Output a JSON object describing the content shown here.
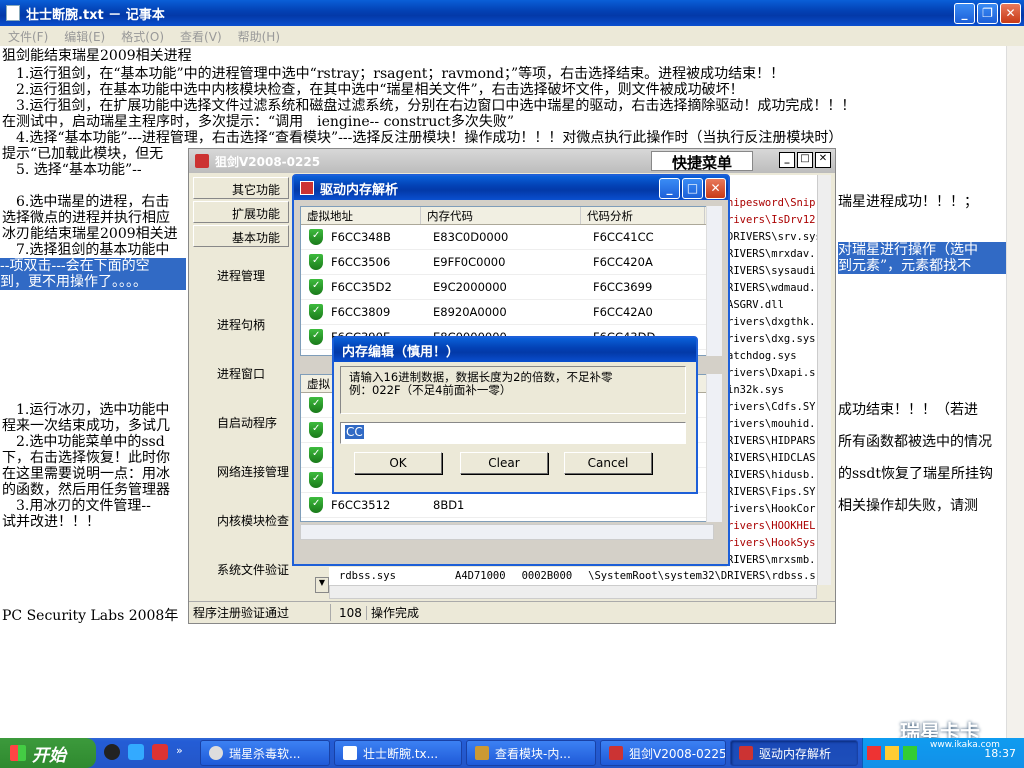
{
  "notepad": {
    "title": "壮士断腕.txt － 记事本",
    "menu": [
      "文件(F)",
      "编辑(E)",
      "格式(O)",
      "查看(V)",
      "帮助(H)"
    ],
    "lines": [
      "狙剑能结束瑞星2009相关进程",
      "　1.运行狙剑，在“基本功能”中的进程管理中选中“rstray；rsagent；ravmond；”等项，右击选择结束。进程被成功结束！！",
      "　2.运行狙剑，在基本功能中选中内核模块检查，在其中选中“瑞星相关文件”，右击选择破坏文件，则文件被成功破坏！",
      "　3.运行狙剑，在扩展功能中选择文件过滤系统和磁盘过滤系统，分别在右边窗口中选中瑞星的驱动，右击选择摘除驱动！成功完成！！！",
      "在测试中，启动瑞星主程序时，多次提示：“调用　iengine-- construct多次失败”",
      "　4.选择“基本功能”---进程管理，右击选择“查看模块”---选择反注册模块！操作成功！！！对微点执行此操作时（当执行反注册模块时）",
      "提示“已加载此模块，但无",
      "　5. 选择“基本功能”--",
      "　6.选中瑞星的进程，右击",
      "选择微点的进程并执行相应",
      "冰刃能结束瑞星2009相关进",
      "　7.选择狙剑的基本功能中",
      "--项双击---会在下面的空",
      "到，更不用操作了。。。。",
      "　1.运行冰刃，选中功能中",
      "程来一次结束成功，多试几",
      "　2.选中功能菜单中的ssd",
      "下，右击选择恢复！此时你",
      "在这里需要说明一点：用冰",
      "的函数，然后用任务管理器",
      "　3.用冰刃的文件管理--",
      "试并改进！！！",
      "PC Security Labs 2008年"
    ],
    "right_frag": [
      "瑞星进程成功！！！；",
      "对瑞星进行操作（选中",
      "到元素”，元素都找不",
      "成功结束！！！（若进",
      "所有函数都被选中的情况",
      "的ssdt恢复了瑞星所挂钩",
      "相关操作却失败，请测"
    ]
  },
  "jujian": {
    "title": "狙剑V2008-0225",
    "quick_menu": "快捷菜单",
    "tabs": [
      "其它功能",
      "扩展功能",
      "基本功能"
    ],
    "sidebar": [
      "进程管理",
      "进程句柄",
      "进程窗口",
      "自启动程序",
      "网络连接管理",
      "内核模块检查",
      "系统文件验证"
    ],
    "paths": [
      "nipesword\\Snip",
      "rivers\\IsDrv12",
      "DRIVERS\\srv.sys",
      "RIVERS\\mrxdav.",
      "RIVERS\\sysaudi",
      "RIVERS\\wdmaud.",
      "ASGRV.dll",
      "rivers\\dxgthk.",
      "rivers\\dxg.sys",
      "atchdog.sys",
      "rivers\\Dxapi.s",
      "in32k.sys",
      "rivers\\Cdfs.SY",
      "rivers\\mouhid.",
      "RIVERS\\HIDPARS",
      "RIVERS\\HIDCLAS",
      "RIVERS\\hidusb.",
      "RIVERS\\Fips.SY",
      "rivers\\HookCor",
      "rivers\\HOOKHEL",
      "rivers\\HookSys",
      "RIVERS\\mrxsmb."
    ],
    "last_row": {
      "name": "rdbss.sys",
      "addr": "A4D71000",
      "size": "0002B000",
      "path": "\\SystemRoot\\system32\\DRIVERS\\rdbss.s"
    },
    "status": {
      "left": "程序注册验证通过",
      "count": "108",
      "msg": "操作完成"
    }
  },
  "driver": {
    "title": "驱动内存解析",
    "headers": [
      "虚拟地址",
      "内存代码",
      "代码分析"
    ],
    "rows": [
      {
        "a": "F6CC348B",
        "c": "E83C0D0000",
        "d": "F6CC41CC"
      },
      {
        "a": "F6CC3506",
        "c": "E9FF0C0000",
        "d": "F6CC420A"
      },
      {
        "a": "F6CC35D2",
        "c": "E9C2000000",
        "d": "F6CC3699"
      },
      {
        "a": "F6CC3809",
        "c": "E8920A0000",
        "d": "F6CC42A0"
      },
      {
        "a": "F6CC390E",
        "c": "E8C0000000",
        "d": "F6CC43DD"
      }
    ],
    "lower_rows": [
      {
        "a": "F",
        "c": "",
        "d": ""
      },
      {
        "a": "F",
        "c": "",
        "d": ""
      },
      {
        "a": "F",
        "c": "",
        "d": ""
      },
      {
        "a": "F",
        "c": "",
        "d": ""
      },
      {
        "a": "F6CC3512",
        "c": "8BD1",
        "d": ""
      }
    ],
    "lower_header": "虚拟"
  },
  "dialog": {
    "title": "内存编辑（慎用！）",
    "prompt1": "请输入16进制数据，数据长度为2的倍数，不足补零",
    "prompt2": "例：022F（不足4前面补一零）",
    "value": "CC",
    "ok": "OK",
    "clear": "Clear",
    "cancel": "Cancel"
  },
  "taskbar": {
    "start": "开始",
    "items": [
      "瑞星杀毒软...",
      "壮士断腕.tx...",
      "查看模块-内...",
      "狙剑V2008-0225",
      "驱动内存解析"
    ],
    "time": "18:37",
    "watermark": "瑞星卡卡",
    "watermark_url": "www.ikaka.com"
  }
}
